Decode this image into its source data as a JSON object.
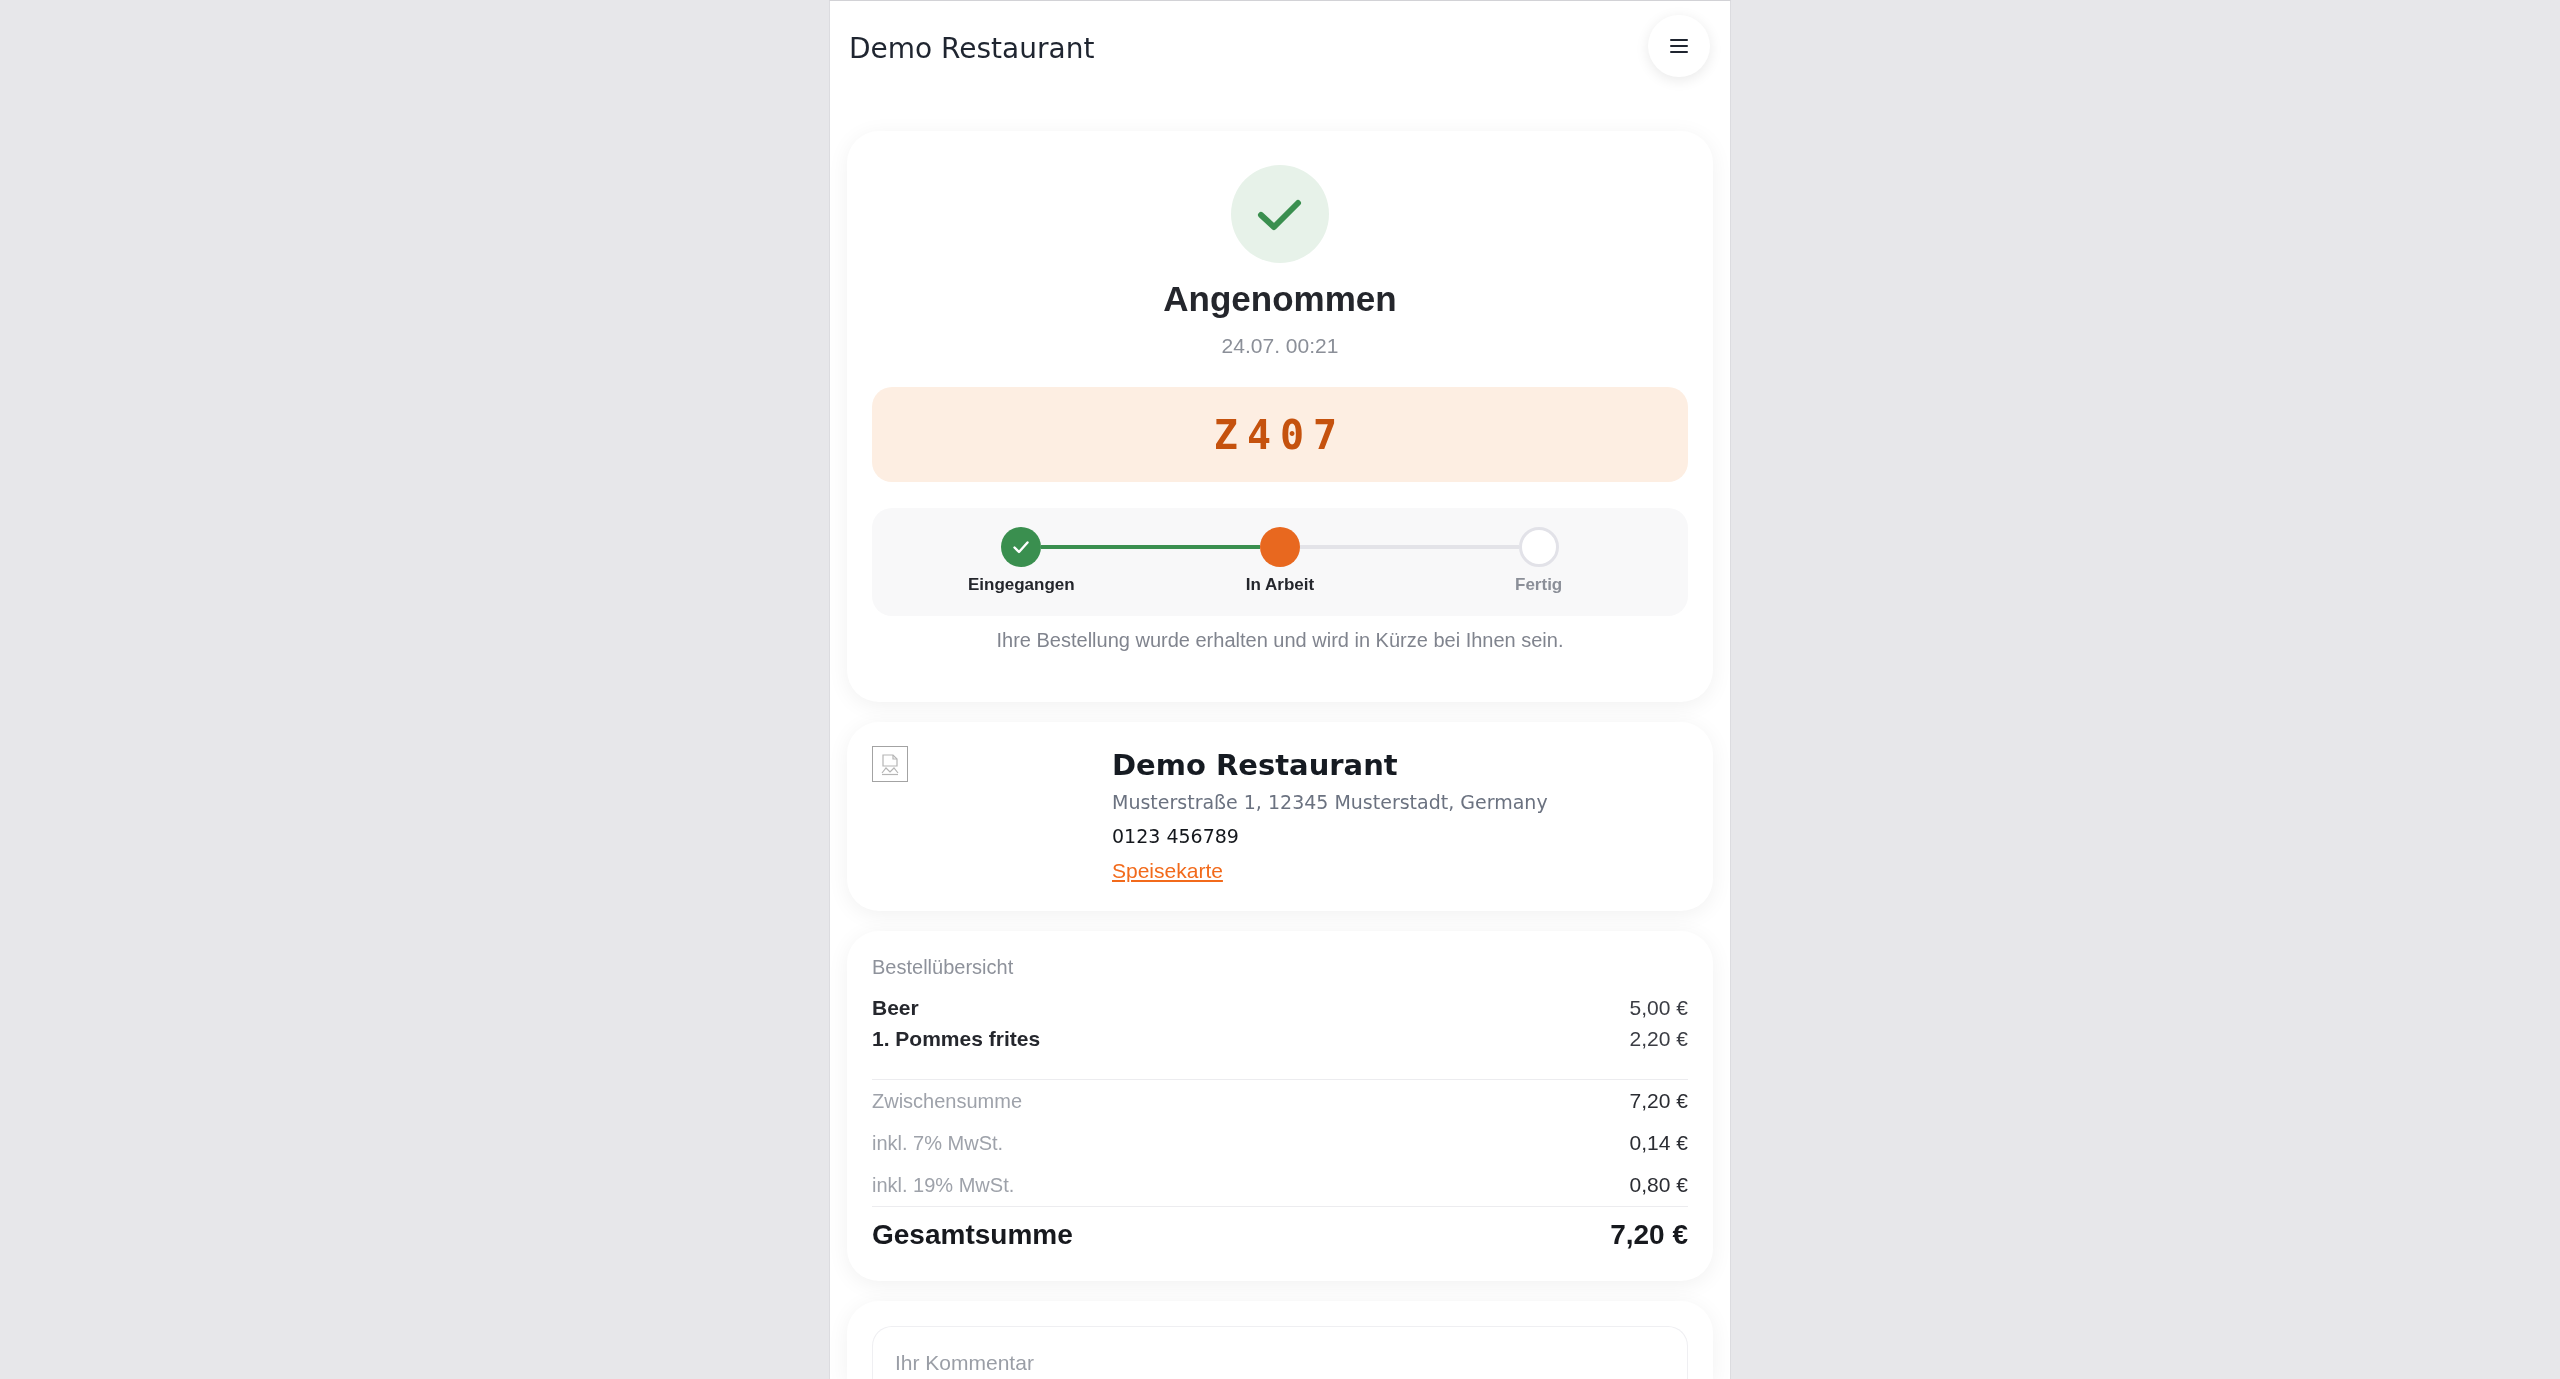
{
  "header": {
    "title": "Demo Restaurant"
  },
  "status": {
    "title": "Angenommen",
    "time": "24.07. 00:21",
    "order_number": "Z407",
    "steps": [
      {
        "label": "Eingegangen",
        "done": true,
        "current": false
      },
      {
        "label": "In Arbeit",
        "done": false,
        "current": true
      },
      {
        "label": "Fertig",
        "done": false,
        "current": false
      }
    ],
    "message": "Ihre Bestellung wurde erhalten und wird in Kürze bei Ihnen sein."
  },
  "restaurant": {
    "name": "Demo Restaurant",
    "address": "Musterstraße 1, 12345 Musterstadt, Germany",
    "phone": "0123 456789",
    "menu_link": "Speisekarte"
  },
  "order_summary": {
    "title": "Bestellübersicht",
    "items": [
      {
        "name": "Beer",
        "price": "5,00 €"
      },
      {
        "name": "1. Pommes frites",
        "price": "2,20 €"
      }
    ],
    "totals": [
      {
        "label": "Zwischensumme",
        "value": "7,20 €"
      },
      {
        "label": "inkl. 7% MwSt.",
        "value": "0,14 €"
      },
      {
        "label": "inkl. 19% MwSt.",
        "value": "0,80 €"
      }
    ],
    "total": {
      "label": "Gesamtsumme",
      "value": "7,20 €"
    }
  },
  "comment": {
    "placeholder": "Ihr Kommentar"
  }
}
